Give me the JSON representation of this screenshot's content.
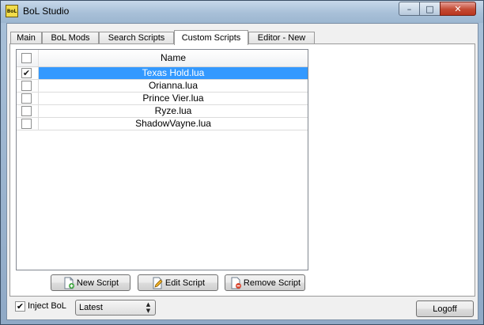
{
  "window": {
    "title": "BoL Studio",
    "icon_text": "BoL",
    "controls": {
      "minimize": "–",
      "maximize": "□",
      "close": "✕"
    }
  },
  "tabs": [
    {
      "label": "Main"
    },
    {
      "label": "BoL Mods"
    },
    {
      "label": "Search Scripts"
    },
    {
      "label": "Custom Scripts",
      "active": true
    },
    {
      "label": "Editor - New"
    }
  ],
  "scripts": {
    "column_header": "Name",
    "rows": [
      {
        "name": "Texas Hold.lua",
        "checked": true,
        "selected": true
      },
      {
        "name": "Orianna.lua",
        "checked": false,
        "selected": false
      },
      {
        "name": "Prince Vier.lua",
        "checked": false,
        "selected": false
      },
      {
        "name": "Ryze.lua",
        "checked": false,
        "selected": false
      },
      {
        "name": "ShadowVayne.lua",
        "checked": false,
        "selected": false
      }
    ]
  },
  "buttons": {
    "new_script": "New Script",
    "edit_script": "Edit Script",
    "remove_script": "Remove Script",
    "logoff": "Logoff"
  },
  "footer": {
    "inject_label": "Inject BoL",
    "inject_checked": true,
    "version_selected": "Latest"
  },
  "glyphs": {
    "check": "✔",
    "combo_up": "▲",
    "combo_down": "▼"
  },
  "colors": {
    "selection": "#3399ff",
    "close_button": "#c44a33"
  }
}
